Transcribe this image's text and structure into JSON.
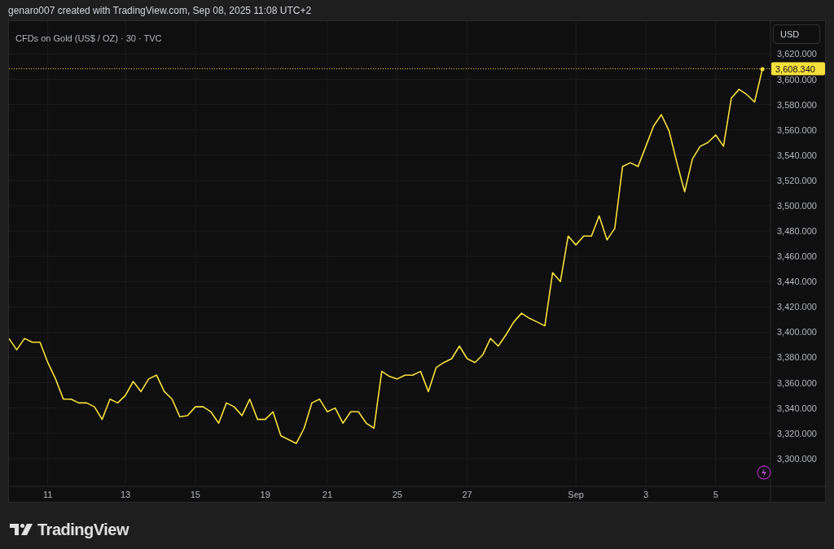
{
  "header": {
    "attribution": "genaro007 created with TradingView.com, Sep 08, 2025 11:08 UTC+2"
  },
  "chart": {
    "legend": "CFDs on Gold (US$ / OZ) · 30 · TVC",
    "currency_button": "USD",
    "chart_data": {
      "type": "line",
      "categories": [
        null,
        null,
        null,
        null,
        null,
        "11",
        null,
        null,
        null,
        null,
        null,
        null,
        null,
        null,
        null,
        "13",
        null,
        null,
        null,
        null,
        null,
        null,
        null,
        null,
        "15",
        null,
        null,
        null,
        null,
        null,
        null,
        null,
        null,
        "19",
        null,
        null,
        null,
        null,
        null,
        null,
        null,
        "21",
        null,
        null,
        null,
        null,
        null,
        null,
        null,
        null,
        "25",
        null,
        null,
        null,
        null,
        null,
        null,
        null,
        null,
        "27",
        null,
        null,
        null,
        null,
        null,
        null,
        null,
        null,
        null,
        null,
        null,
        null,
        null,
        "Sep",
        null,
        null,
        null,
        null,
        null,
        null,
        null,
        null,
        "3",
        null,
        null,
        null,
        null,
        null,
        null,
        null,
        null,
        "5",
        null,
        null,
        null,
        null,
        null,
        null
      ],
      "series": [
        {
          "color": "#f7e03c",
          "values": [
            3395,
            3386,
            3395,
            3392,
            3392,
            3376,
            3363,
            3347,
            3347,
            3344,
            3344,
            3341,
            3331,
            3347,
            3344,
            3350,
            3361,
            3353,
            3363,
            3366,
            3353,
            3347,
            3333,
            3334,
            3341,
            3341,
            3337,
            3328,
            3344,
            3341,
            3334,
            3347,
            3331,
            3331,
            3337,
            3318,
            3315,
            3312,
            3324,
            3344,
            3347,
            3337,
            3340,
            3328,
            3337,
            3337,
            3328,
            3324,
            3369,
            3365,
            3363,
            3366,
            3366,
            3369,
            3353,
            3372,
            3376,
            3379,
            3389,
            3379,
            3376,
            3382,
            3395,
            3389,
            3398,
            3408,
            3415,
            3411,
            3408,
            3405,
            3447,
            3440,
            3476,
            3469,
            3476,
            3476,
            3492,
            3473,
            3482,
            3531,
            3534,
            3531,
            3547,
            3563,
            3572,
            3559,
            3534,
            3511,
            3537,
            3547,
            3550,
            3556,
            3547,
            3585,
            3592,
            3588,
            3582,
            3608
          ]
        }
      ],
      "grid": true,
      "ref_lines": [
        {
          "axis": "y",
          "value": 3608.34,
          "label": "3,608.340"
        }
      ],
      "ylim": [
        3278,
        3646
      ],
      "yticks": [
        {
          "value": 3300,
          "label": "3,300.000"
        },
        {
          "value": 3320,
          "label": "3,320.000"
        },
        {
          "value": 3340,
          "label": "3,340.000"
        },
        {
          "value": 3360,
          "label": "3,360.000"
        },
        {
          "value": 3380,
          "label": "3,380.000"
        },
        {
          "value": 3400,
          "label": "3,400.000"
        },
        {
          "value": 3420,
          "label": "3,420.000"
        },
        {
          "value": 3440,
          "label": "3,440.000"
        },
        {
          "value": 3460,
          "label": "3,460.000"
        },
        {
          "value": 3480,
          "label": "3,480.000"
        },
        {
          "value": 3500,
          "label": "3,500.000"
        },
        {
          "value": 3520,
          "label": "3,520.000"
        },
        {
          "value": 3540,
          "label": "3,540.000"
        },
        {
          "value": 3560,
          "label": "3,560.000"
        },
        {
          "value": 3580,
          "label": "3,580.000"
        },
        {
          "value": 3600,
          "label": "3,600.000"
        },
        {
          "value": 3620,
          "label": "3,620.000"
        }
      ]
    }
  },
  "footer": {
    "logo_text": "TradingView"
  }
}
